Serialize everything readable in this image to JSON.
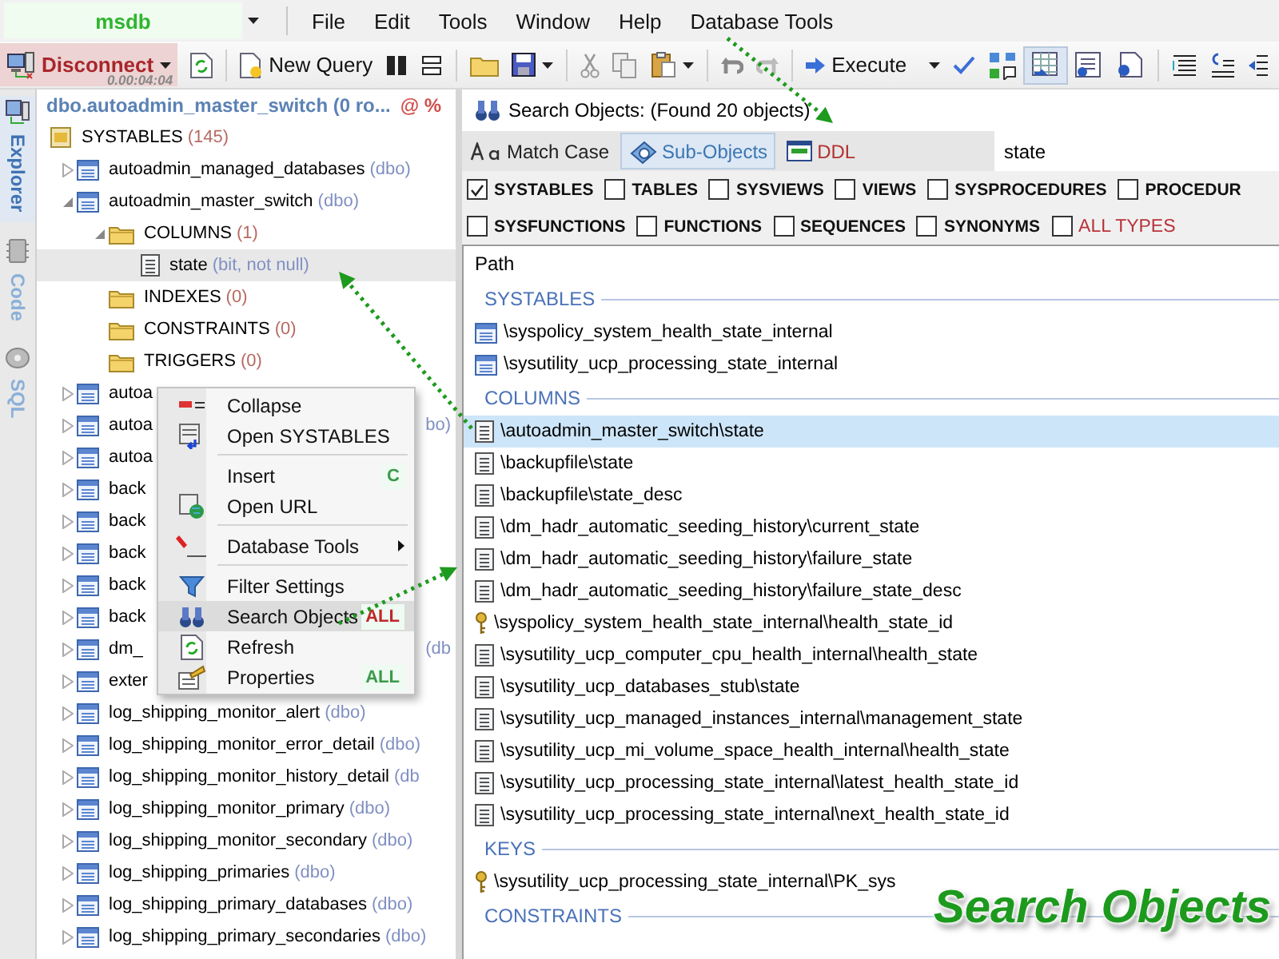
{
  "db_selector": {
    "value": "msdb"
  },
  "menu": [
    "File",
    "Edit",
    "Tools",
    "Window",
    "Help",
    "Database Tools"
  ],
  "toolbar": {
    "disconnect": {
      "label": "Disconnect",
      "timer": "0.00:04:04"
    },
    "new_query": "New Query",
    "execute": "Execute"
  },
  "side_tabs": [
    {
      "label": "Explorer",
      "selected": true
    },
    {
      "label": "Code",
      "selected": false
    },
    {
      "label": "SQL",
      "selected": false
    }
  ],
  "explorer": {
    "title": "dbo.autoadmin_master_switch (0 ro...",
    "title_marks": "@ %",
    "tree": [
      {
        "kind": "root",
        "name": "SYSTABLES",
        "count": "(145)",
        "selected": false,
        "children": [
          {
            "kind": "table",
            "name": "autoadmin_managed_databases",
            "schema": "(dbo)",
            "expanded": false,
            "selected": false
          },
          {
            "kind": "table",
            "name": "autoadmin_master_switch",
            "schema": "(dbo)",
            "expanded": true,
            "selected": false,
            "children": [
              {
                "kind": "folder",
                "name": "COLUMNS",
                "count": "(1)",
                "expanded": true,
                "selected": false,
                "children": [
                  {
                    "kind": "column",
                    "name": "state",
                    "schema": "(bit, not null)",
                    "selected": true
                  }
                ]
              },
              {
                "kind": "folder",
                "name": "INDEXES",
                "count": "(0)",
                "selected": false
              },
              {
                "kind": "folder",
                "name": "CONSTRAINTS",
                "count": "(0)",
                "selected": false
              },
              {
                "kind": "folder",
                "name": "TRIGGERS",
                "count": "(0)",
                "selected": false
              }
            ]
          },
          {
            "kind": "table",
            "name": "autoa",
            "expanded": false,
            "selected": false
          },
          {
            "kind": "table",
            "name": "autoa",
            "tail": "bo)",
            "expanded": false,
            "selected": false
          },
          {
            "kind": "table",
            "name": "autoa",
            "expanded": false,
            "selected": false
          },
          {
            "kind": "table",
            "name": "back",
            "expanded": false,
            "selected": false
          },
          {
            "kind": "table",
            "name": "back",
            "expanded": false,
            "selected": false
          },
          {
            "kind": "table",
            "name": "back",
            "expanded": false,
            "selected": false
          },
          {
            "kind": "table",
            "name": "back",
            "expanded": false,
            "selected": false
          },
          {
            "kind": "table",
            "name": "back",
            "expanded": false,
            "selected": false
          },
          {
            "kind": "table",
            "name": "dm_",
            "tail": "(db",
            "expanded": false,
            "selected": false
          },
          {
            "kind": "table",
            "name": "exter",
            "expanded": false,
            "selected": false
          },
          {
            "kind": "table",
            "name": "log_shipping_monitor_alert",
            "schema": "(dbo)",
            "expanded": false,
            "selected": false
          },
          {
            "kind": "table",
            "name": "log_shipping_monitor_error_detail",
            "schema": "(dbo)",
            "expanded": false,
            "selected": false
          },
          {
            "kind": "table",
            "name": "log_shipping_monitor_history_detail",
            "schema": "(db",
            "expanded": false,
            "selected": false
          },
          {
            "kind": "table",
            "name": "log_shipping_monitor_primary",
            "schema": "(dbo)",
            "expanded": false,
            "selected": false
          },
          {
            "kind": "table",
            "name": "log_shipping_monitor_secondary",
            "schema": "(dbo)",
            "expanded": false,
            "selected": false
          },
          {
            "kind": "table",
            "name": "log_shipping_primaries",
            "schema": "(dbo)",
            "expanded": false,
            "selected": false
          },
          {
            "kind": "table",
            "name": "log_shipping_primary_databases",
            "schema": "(dbo)",
            "expanded": false,
            "selected": false
          },
          {
            "kind": "table",
            "name": "log_shipping_primary_secondaries",
            "schema": "(dbo)",
            "expanded": false,
            "selected": false
          }
        ]
      }
    ]
  },
  "context_menu": [
    {
      "kind": "item",
      "label": "Collapse",
      "selected": false
    },
    {
      "kind": "item",
      "label": "Open SYSTABLES",
      "selected": false
    },
    {
      "kind": "separator"
    },
    {
      "kind": "item",
      "label": "Insert",
      "shortcut": "C",
      "color": "#3c9a4a",
      "selected": false
    },
    {
      "kind": "item",
      "label": "Open URL",
      "selected": false
    },
    {
      "kind": "separator"
    },
    {
      "kind": "submenu",
      "label": "Database Tools",
      "selected": false
    },
    {
      "kind": "separator"
    },
    {
      "kind": "item",
      "label": "Filter Settings",
      "selected": false
    },
    {
      "kind": "item",
      "label": "Search Objects",
      "shortcut": "ALL",
      "color": "#c0282c",
      "selected": true
    },
    {
      "kind": "item",
      "label": "Refresh",
      "selected": false
    },
    {
      "kind": "item",
      "label": "Properties",
      "shortcut": "ALL",
      "color": "#3c9a4a",
      "selected": false
    }
  ],
  "search": {
    "title": "Search Objects: (Found 20 objects)",
    "options": [
      {
        "kind": "match_case",
        "label": "Match Case",
        "selected": false
      },
      {
        "kind": "sub_objects",
        "label": "Sub-Objects",
        "selected": true
      },
      {
        "kind": "ddl",
        "label": "DDL",
        "selected": false
      }
    ],
    "query": "state",
    "filter_rows": [
      [
        {
          "label": "SYSTABLES",
          "checked": true
        },
        {
          "label": "TABLES",
          "checked": false
        },
        {
          "label": "SYSVIEWS",
          "checked": false
        },
        {
          "label": "VIEWS",
          "checked": false
        },
        {
          "label": "SYSPROCEDURES",
          "checked": false
        },
        {
          "label": "PROCEDUR",
          "checked": false
        }
      ],
      [
        {
          "label": "SYSFUNCTIONS",
          "checked": false
        },
        {
          "label": "FUNCTIONS",
          "checked": false
        },
        {
          "label": "SEQUENCES",
          "checked": false
        },
        {
          "label": "SYNONYMS",
          "checked": false
        },
        {
          "label": "ALL TYPES",
          "kind": "all",
          "checked": false
        }
      ]
    ],
    "column_header": "Path",
    "groups": [
      {
        "title": "SYSTABLES",
        "items": [
          {
            "kind": "table",
            "path": "\\syspolicy_system_health_state_internal",
            "selected": false
          },
          {
            "kind": "table",
            "path": "\\sysutility_ucp_processing_state_internal",
            "selected": false
          }
        ]
      },
      {
        "title": "COLUMNS",
        "items": [
          {
            "kind": "column",
            "path": "\\autoadmin_master_switch\\state",
            "selected": true
          },
          {
            "kind": "column",
            "path": "\\backupfile\\state",
            "selected": false
          },
          {
            "kind": "column",
            "path": "\\backupfile\\state_desc",
            "selected": false
          },
          {
            "kind": "column",
            "path": "\\dm_hadr_automatic_seeding_history\\current_state",
            "selected": false
          },
          {
            "kind": "column",
            "path": "\\dm_hadr_automatic_seeding_history\\failure_state",
            "selected": false
          },
          {
            "kind": "column",
            "path": "\\dm_hadr_automatic_seeding_history\\failure_state_desc",
            "selected": false
          },
          {
            "kind": "key",
            "path": "\\syspolicy_system_health_state_internal\\health_state_id",
            "selected": false
          },
          {
            "kind": "column",
            "path": "\\sysutility_ucp_computer_cpu_health_internal\\health_state",
            "selected": false
          },
          {
            "kind": "column",
            "path": "\\sysutility_ucp_databases_stub\\state",
            "selected": false
          },
          {
            "kind": "column",
            "path": "\\sysutility_ucp_managed_instances_internal\\management_state",
            "selected": false
          },
          {
            "kind": "column",
            "path": "\\sysutility_ucp_mi_volume_space_health_internal\\health_state",
            "selected": false
          },
          {
            "kind": "column",
            "path": "\\sysutility_ucp_processing_state_internal\\latest_health_state_id",
            "selected": false
          },
          {
            "kind": "column",
            "path": "\\sysutility_ucp_processing_state_internal\\next_health_state_id",
            "selected": false
          }
        ]
      },
      {
        "title": "KEYS",
        "items": [
          {
            "kind": "key",
            "path": "\\sysutility_ucp_processing_state_internal\\PK_sys",
            "selected": false
          }
        ]
      },
      {
        "title": "CONSTRAINTS"
      }
    ]
  },
  "caption": "Search Objects"
}
